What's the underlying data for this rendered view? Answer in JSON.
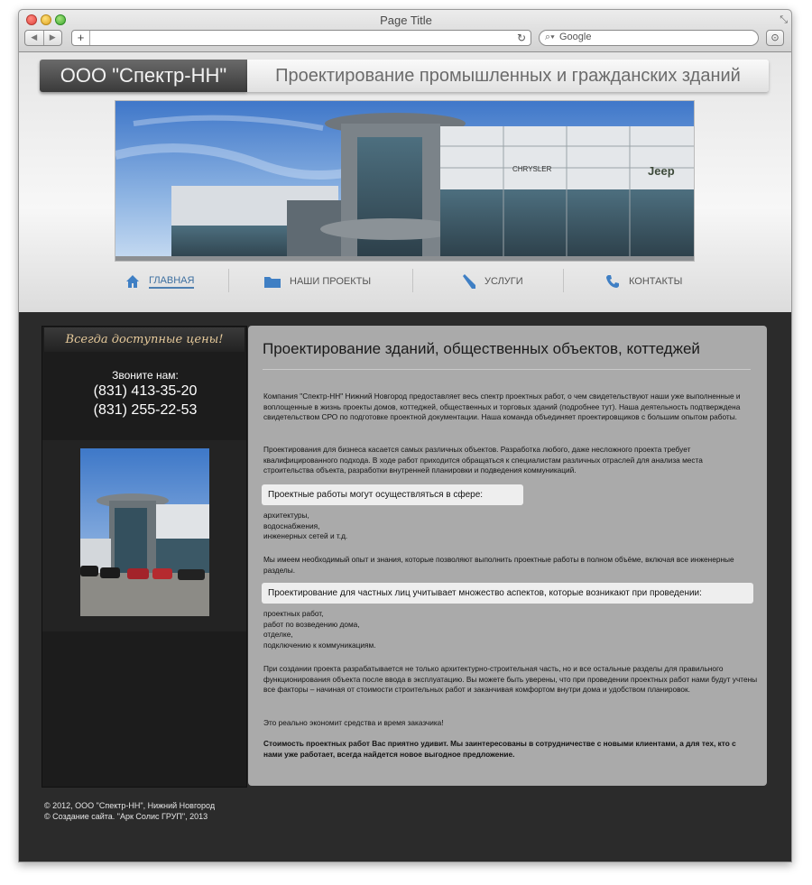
{
  "window": {
    "title": "Page Title",
    "search_placeholder": "Google",
    "nav_back": "◀",
    "nav_forward": "▶",
    "add_tab": "+",
    "reload_icon": "↻",
    "search_icon": "⌕▾",
    "download_icon": "⊙",
    "resize_icon": "⤡"
  },
  "site": {
    "logo": "ООО \"Спектр-НН\"",
    "tagline": "Проектирование промышленных и гражданских зданий"
  },
  "nav": {
    "items": [
      {
        "label": "ГЛАВНАЯ",
        "icon": "home-icon",
        "active": true
      },
      {
        "label": "НАШИ ПРОЕКТЫ",
        "icon": "folder-icon",
        "active": false
      },
      {
        "label": "УСЛУГИ",
        "icon": "pencil-icon",
        "active": false
      },
      {
        "label": "КОНТАКТЫ",
        "icon": "phone-icon",
        "active": false
      }
    ]
  },
  "sidebar": {
    "heading": "Всегда доступные цены!",
    "call_label": "Звоните нам:",
    "phone1": "(831) 413-35-20",
    "phone2": "(831) 255-22-53"
  },
  "banner": {
    "sign_chrysler": "CHRYSLER",
    "sign_jeep": "Jeep"
  },
  "content": {
    "title": "Проектирование зданий, общественных объектов, коттеджей",
    "p1": "Компания \"Спектр-НН\" Нижний Новгород предоставляет весь спектр проектных работ, о чем свидетельствуют наши уже выполненные и воплощенные в жизнь проекты домов, коттеджей, общественных и торговых зданий (подробнее тут). Наша деятельность подтверждена свидетельством СРО по подготовке проектной документации. Наша команда объединяет проектировщиков с большим опытом работы.",
    "p2": "Проектирования для бизнеса касается самых различных объектов. Разработка любого, даже несложного проекта требует квалифицированного подхода. В ходе работ приходится обращаться к специалистам различных отраслей для анализа места строительства объекта, разработки внутренней планировки и подведения коммуникаций.",
    "box1": "Проектные работы могут осуществляться в сфере:",
    "list1": [
      "архитектуры,",
      "водоснабжения,",
      "инженерных сетей и т.д."
    ],
    "p3": "Мы имеем необходимый опыт и знания, которые позволяют выполнить проектные работы в полном объёме, включая все инженерные разделы.",
    "box2": "Проектирование для частных лиц учитывает множество аспектов, которые возникают при проведении:",
    "list2": [
      "проектных работ,",
      "работ по возведению дома,",
      "отделке,",
      "подключению к коммуникациям."
    ],
    "p4": "При создании проекта разрабатывается не только архитектурно-строительная часть, но и все остальные разделы для правильного функционирования объекта после ввода в эксплуатацию. Вы можете быть уверены, что при проведении проектных работ нами будут учтены все факторы – начиная от стоимости строительных работ и заканчивая комфортом внутри дома и удобством планировок.",
    "p5": "Это реально экономит средства и время заказчика!",
    "p6": "Стоимость проектных работ Вас приятно удивит. Мы заинтересованы в сотрудничестве с новыми клиентами, а для тех, кто с нами уже работает, всегда найдется новое выгодное предложение."
  },
  "footer": {
    "line1": "© 2012, ООО \"Спектр-НН\", Нижний Новгород",
    "line2": "© Создание сайта. \"Арк Солис ГРУП\", 2013"
  }
}
